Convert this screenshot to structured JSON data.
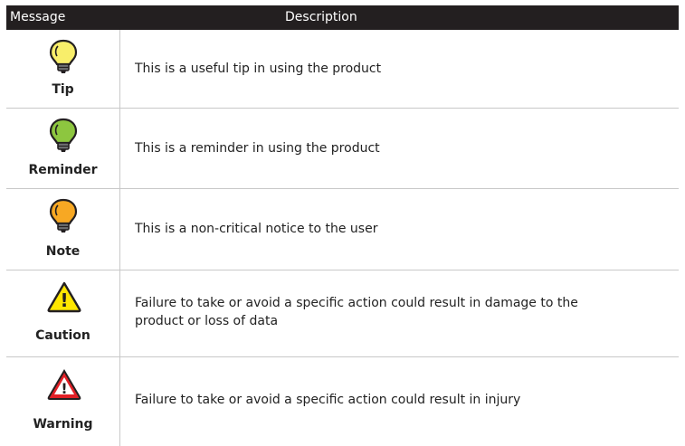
{
  "header": {
    "message": "Message",
    "description": "Description"
  },
  "rows": [
    {
      "label": "Tip",
      "icon": "lightbulb-yellow-icon",
      "color": "#f8ee6a",
      "description": "This is a useful tip in using the product"
    },
    {
      "label": "Reminder",
      "icon": "lightbulb-green-icon",
      "color": "#8dc63f",
      "description": "This is a reminder in using the product"
    },
    {
      "label": "Note",
      "icon": "lightbulb-orange-icon",
      "color": "#f7a823",
      "description": "This is a non-critical notice to the user"
    },
    {
      "label": "Caution",
      "icon": "caution-triangle-icon",
      "color": "#ffe600",
      "symbol": "!",
      "description": "Failure to take or avoid a specific action could result in damage to the product or loss of data"
    },
    {
      "label": "Warning",
      "icon": "warning-triangle-icon",
      "color": "#e21f26",
      "symbol": "!",
      "description": "Failure to take or avoid a specific action could result in injury"
    }
  ]
}
